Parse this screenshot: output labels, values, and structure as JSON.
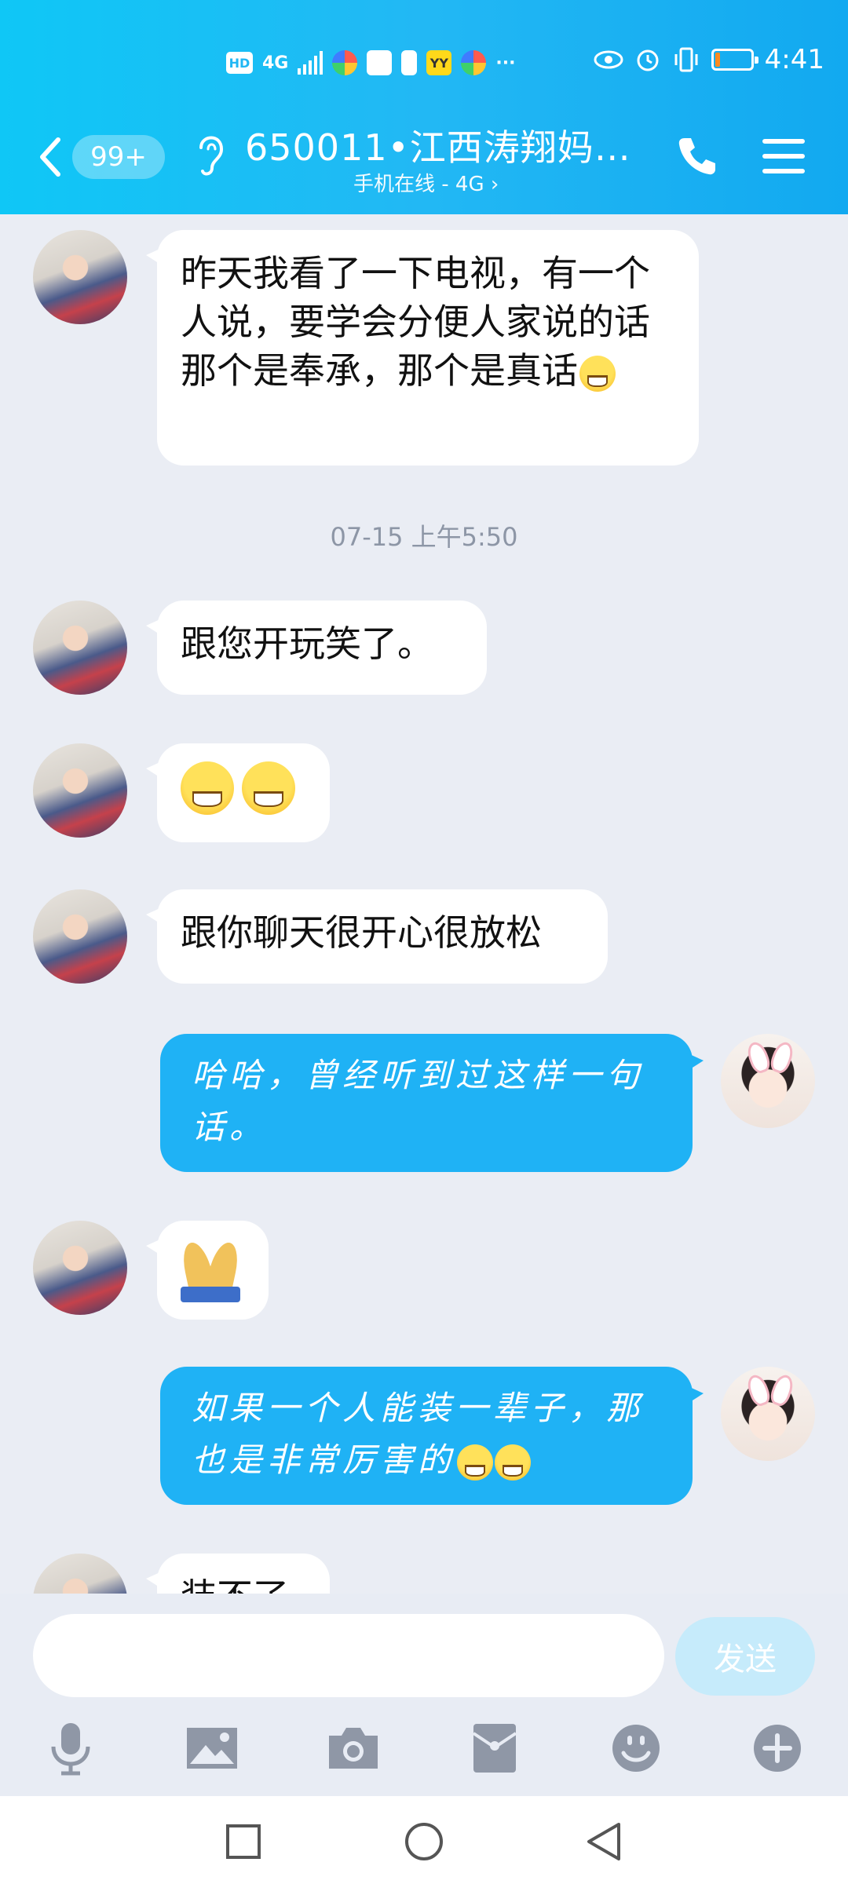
{
  "status_bar": {
    "network_hd": "HD",
    "network_type": "4G",
    "time": "4:41",
    "more": "···",
    "battery_level": 0.16
  },
  "header": {
    "badge": "99+",
    "title": "650011•江西涛翔妈g...",
    "subtitle": "手机在线 - 4G ›"
  },
  "messages": [
    {
      "from": "contact",
      "text": "昨天我看了一下电视，有一个人说，要学会分便人家说的话那个是奉承，那个是真话",
      "emoji": "laughing-tears"
    },
    {
      "type": "timestamp",
      "text": "07-15 上午5:50"
    },
    {
      "from": "contact",
      "text": "跟您开玩笑了。"
    },
    {
      "from": "contact",
      "text": "",
      "emoji": "grin-grin"
    },
    {
      "from": "contact",
      "text": "跟你聊天很开心很放松"
    },
    {
      "from": "me",
      "text": "哈哈，曾经听到过这样一句话。"
    },
    {
      "from": "contact",
      "text": "",
      "emoji": "pray"
    },
    {
      "from": "me",
      "text": "如果一个人能装一辈子，那也是非常厉害的",
      "emoji": "grin-grin"
    },
    {
      "from": "contact",
      "text": "装不了"
    }
  ],
  "input": {
    "placeholder": "",
    "value": "",
    "send_label": "发送"
  },
  "toolbar": [
    "microphone-icon",
    "image-icon",
    "camera-icon",
    "red-packet-icon",
    "emoji-icon",
    "plus-icon"
  ],
  "colors": {
    "header_start": "#0fc7f6",
    "header_end": "#12a9f0",
    "outgoing_bubble": "#1fb2f5",
    "background": "#eaedf4"
  }
}
